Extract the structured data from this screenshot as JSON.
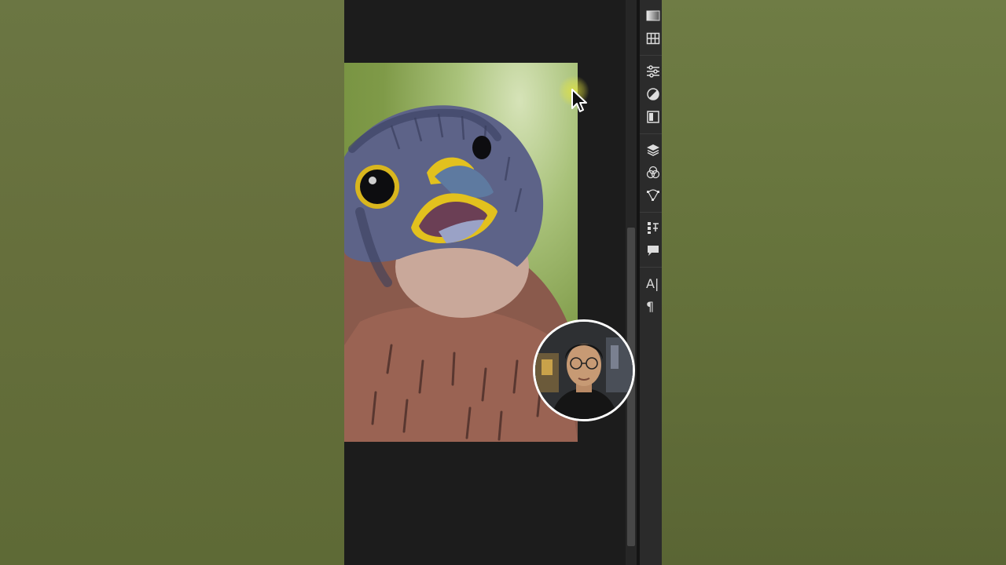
{
  "app": {
    "name": "Photo editor",
    "canvas": {
      "image_subject": "kestrel-portrait"
    },
    "right_panel": {
      "tools": [
        {
          "id": "gradients",
          "icon": "gradient-icon"
        },
        {
          "id": "patterns",
          "icon": "grid-icon"
        },
        {
          "id": "adjustments",
          "icon": "sliders-icon"
        },
        {
          "id": "color",
          "icon": "half-circle-icon"
        },
        {
          "id": "libraries",
          "icon": "panel-icon"
        },
        {
          "id": "layers",
          "icon": "layers-icon"
        },
        {
          "id": "channels",
          "icon": "channels-icon"
        },
        {
          "id": "paths",
          "icon": "paths-icon"
        },
        {
          "id": "properties",
          "icon": "properties-icon"
        },
        {
          "id": "comments",
          "icon": "comment-icon"
        },
        {
          "id": "character",
          "icon": "character-icon",
          "glyph": "A|"
        },
        {
          "id": "paragraph",
          "icon": "paragraph-icon",
          "glyph": "¶"
        }
      ]
    },
    "colors": {
      "workspace": "#1c1c1c",
      "panel": "#2b2b2b",
      "cursor_highlight": "#e6e63c",
      "webcam_ring": "#ffffff"
    }
  }
}
